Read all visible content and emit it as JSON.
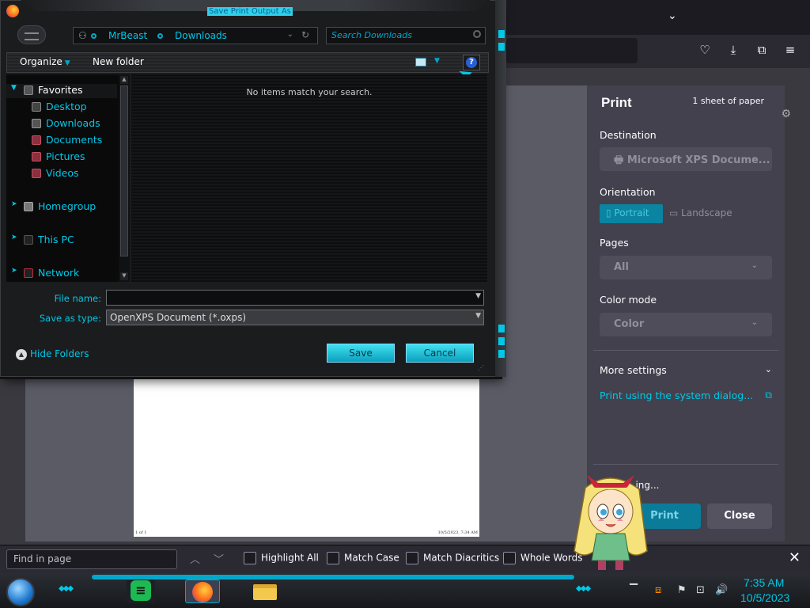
{
  "dialog": {
    "title": "Save Print Output As",
    "address": [
      "MrBeast",
      "Downloads"
    ],
    "search_placeholder": "Search Downloads",
    "toolbar": {
      "organize": "Organize",
      "new_folder": "New folder"
    },
    "nav": {
      "favorites": "Favorites",
      "items": [
        "Desktop",
        "Downloads",
        "Documents",
        "Pictures",
        "Videos"
      ],
      "homegroup": "Homegroup",
      "this_pc": "This PC",
      "network": "Network"
    },
    "empty_message": "No items match your search.",
    "file_name_label": "File name:",
    "file_name_value": "",
    "save_type_label": "Save as type:",
    "save_type_value": "OpenXPS Document (*.oxps)",
    "hide_folders": "Hide Folders",
    "save": "Save",
    "cancel": "Cancel"
  },
  "print_panel": {
    "title": "Print",
    "sheets": "1 sheet of paper",
    "destination_label": "Destination",
    "destination_value": "Microsoft XPS Docume...",
    "orientation_label": "Orientation",
    "portrait": "Portrait",
    "landscape": "Landscape",
    "pages_label": "Pages",
    "pages_value": "All",
    "color_label": "Color mode",
    "color_value": "Color",
    "more_settings": "More settings",
    "system_dialog": "Print using the system dialog...",
    "saving": "...ing...",
    "print": "Print",
    "close": "Close"
  },
  "preview": {
    "footer_left": "1 of 1",
    "footer_right": "10/5/2023, 7:34 AM"
  },
  "findbar": {
    "placeholder": "Find in page",
    "highlight_all": "Highlight All",
    "match_case": "Match Case",
    "match_diacritics": "Match Diacritics",
    "whole_words": "Whole Words"
  },
  "taskbar": {
    "time": "7:35 AM",
    "date": "10/5/2023"
  },
  "colors": {
    "accent": "#00c8e6",
    "panel": "#42414d",
    "dialog_bg": "#1b1c1e"
  }
}
